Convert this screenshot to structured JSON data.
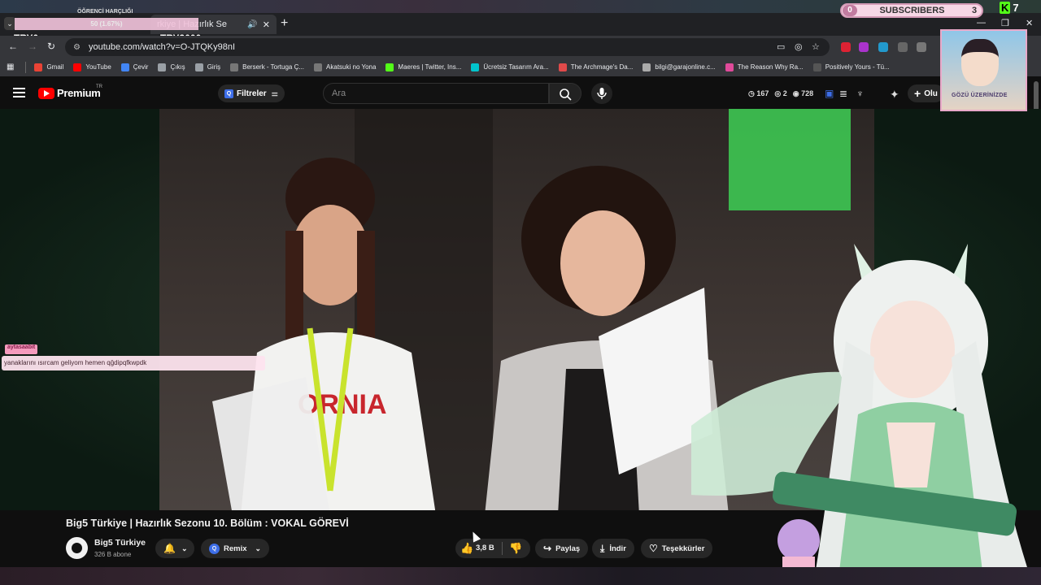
{
  "browser": {
    "active_tab_title": "rkiye | Hazırlık Se",
    "url": "youtube.com/watch?v=O-JTQKy98nI",
    "bookmarks": [
      {
        "label": "Gmail",
        "color": "#ea4335"
      },
      {
        "label": "YouTube",
        "color": "#ff0000"
      },
      {
        "label": "Çevir",
        "color": "#4285f4"
      },
      {
        "label": "Çıkış",
        "color": "#9aa0a6"
      },
      {
        "label": "Giriş",
        "color": "#9aa0a6"
      },
      {
        "label": "Berserk - Tortuga Ç...",
        "color": "#777777"
      },
      {
        "label": "Akatsuki no Yona",
        "color": "#777777"
      },
      {
        "label": "Maeres | Twitter, Ins...",
        "color": "#53fc18"
      },
      {
        "label": "Ücretsiz Tasarım Ara...",
        "color": "#00c4cc"
      },
      {
        "label": "The Archmage's Da...",
        "color": "#e04a4a"
      },
      {
        "label": "bilgi@garajonline.c...",
        "color": "#aaaaaa"
      },
      {
        "label": "The Reason Why Ra...",
        "color": "#e04a9a"
      },
      {
        "label": "Positively Yours - Tü...",
        "color": "#555555"
      }
    ]
  },
  "stream_overlay": {
    "top_text": "ÖĞRENCİ HARÇLIĞI",
    "progress_text": "50 (1.67%)",
    "try_left": "TRY0",
    "try_right": "TRY3000",
    "subs_left_count": "0",
    "subs_label": "SUBSCRIBERS",
    "subs_right_count": "3",
    "k_count": "7",
    "chat_username": "aytasaabit",
    "chat_message": "yanaklarını ısırcam geliyom hemen qğdipqfkwpdk",
    "webcam_caption": "GÖZÜ ÜZERİNİZDE"
  },
  "youtube": {
    "logo_text": "Premium",
    "region": "TR",
    "filter_label": "Filtreler",
    "search_placeholder": "Ara",
    "stats": {
      "a": "167",
      "b": "2",
      "c": "728"
    },
    "create_label": "Olu",
    "video_title": "Big5 Türkiye | Hazırlık Sezonu 10. Bölüm : VOKAL GÖREVİ",
    "channel_name": "Big5 Türkiye",
    "channel_subs": "326 B abone",
    "remix_label": "Remix",
    "like_count": "3,8 B",
    "share_label": "Paylaş",
    "download_label": "İndir",
    "thanks_label": "Teşekkürler"
  }
}
